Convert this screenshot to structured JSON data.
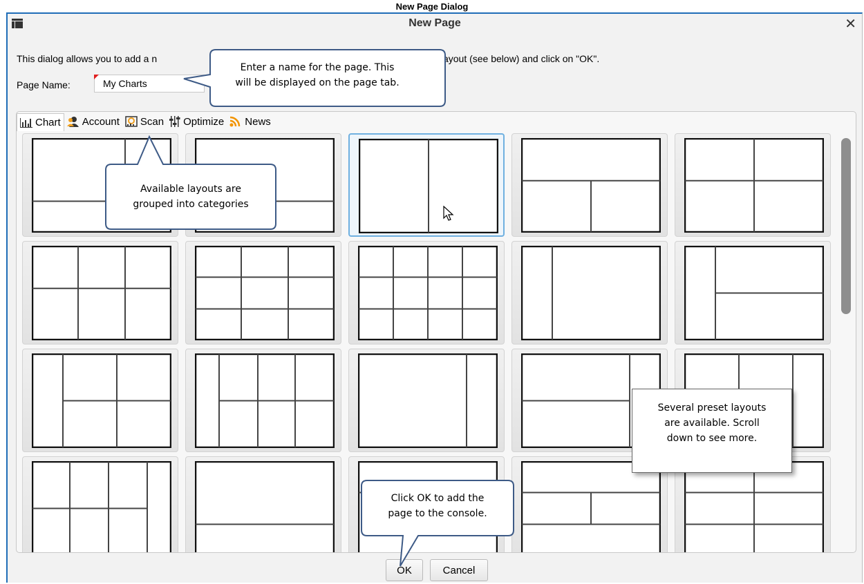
{
  "document": {
    "title": "New Page Dialog"
  },
  "dialog": {
    "title": "New Page",
    "close_icon": "close-icon",
    "intro_text": "This dialog allows you to add a n",
    "intro_text_end": "low, choose a layout (see below) and click on \"OK\".",
    "page_name_label": "Page Name:",
    "page_name_value": "My Charts"
  },
  "tabs": [
    {
      "label": "Chart",
      "icon": "bar-chart-icon",
      "active": true
    },
    {
      "label": "Account",
      "icon": "user-icon"
    },
    {
      "label": "Scan",
      "icon": "scan-icon"
    },
    {
      "label": "Optimize",
      "icon": "sliders-icon"
    },
    {
      "label": "News",
      "icon": "rss-icon"
    }
  ],
  "buttons": {
    "ok": "OK",
    "cancel": "Cancel"
  },
  "callouts": {
    "page_name": [
      "Enter a name for the page.  This",
      "will be displayed on the page tab."
    ],
    "categories": [
      "Available layouts are",
      "grouped into categories"
    ],
    "presets": [
      "Several preset layouts",
      "are available.  Scroll",
      "down to see more."
    ],
    "ok": [
      "Click OK to add the",
      "page to the console."
    ]
  },
  "colors": {
    "accent_border": "#1e6db7",
    "callout_border": "#3d5a86",
    "selected_cell": "#6fb0e0"
  }
}
